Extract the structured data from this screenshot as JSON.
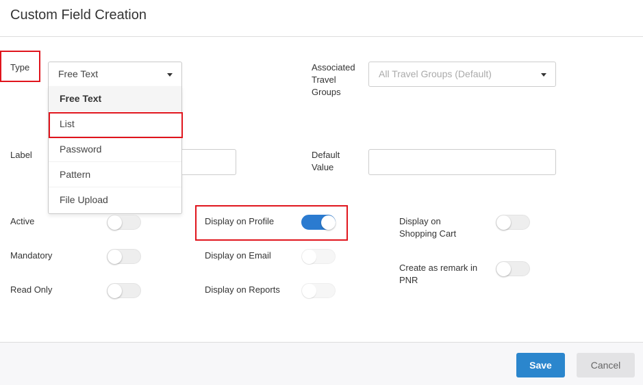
{
  "header": {
    "title": "Custom Field Creation"
  },
  "type_field": {
    "label": "Type",
    "value": "Free Text",
    "options": [
      "Free Text",
      "List",
      "Password",
      "Pattern",
      "File Upload"
    ],
    "selected_index": 0
  },
  "travel_groups": {
    "label_line1": "Associated",
    "label_line2": "Travel",
    "label_line3": "Groups",
    "value": "All Travel Groups (Default)"
  },
  "label_field": {
    "label": "Label",
    "value": ""
  },
  "default_value": {
    "label_line1": "Default",
    "label_line2": "Value",
    "value": ""
  },
  "toggles": {
    "active": {
      "label": "Active",
      "on": false
    },
    "mandatory": {
      "label": "Mandatory",
      "on": false
    },
    "read_only": {
      "label": "Read Only",
      "on": false
    },
    "display_on_profile": {
      "label": "Display on Profile",
      "on": true
    },
    "display_on_email": {
      "label": "Display on Email",
      "on": false
    },
    "display_on_reports": {
      "label": "Display on Reports",
      "on": false
    },
    "display_on_cart": {
      "label_line1": "Display on",
      "label_line2": "Shopping Cart",
      "on": false
    },
    "remark_in_pnr": {
      "label_line1": "Create as remark in",
      "label_line2": "PNR",
      "on": false
    }
  },
  "footer": {
    "save_label": "Save",
    "cancel_label": "Cancel"
  },
  "colors": {
    "accent": "#2b86cd",
    "toggle_on": "#2b7bd0",
    "highlight": "#e0141c"
  }
}
